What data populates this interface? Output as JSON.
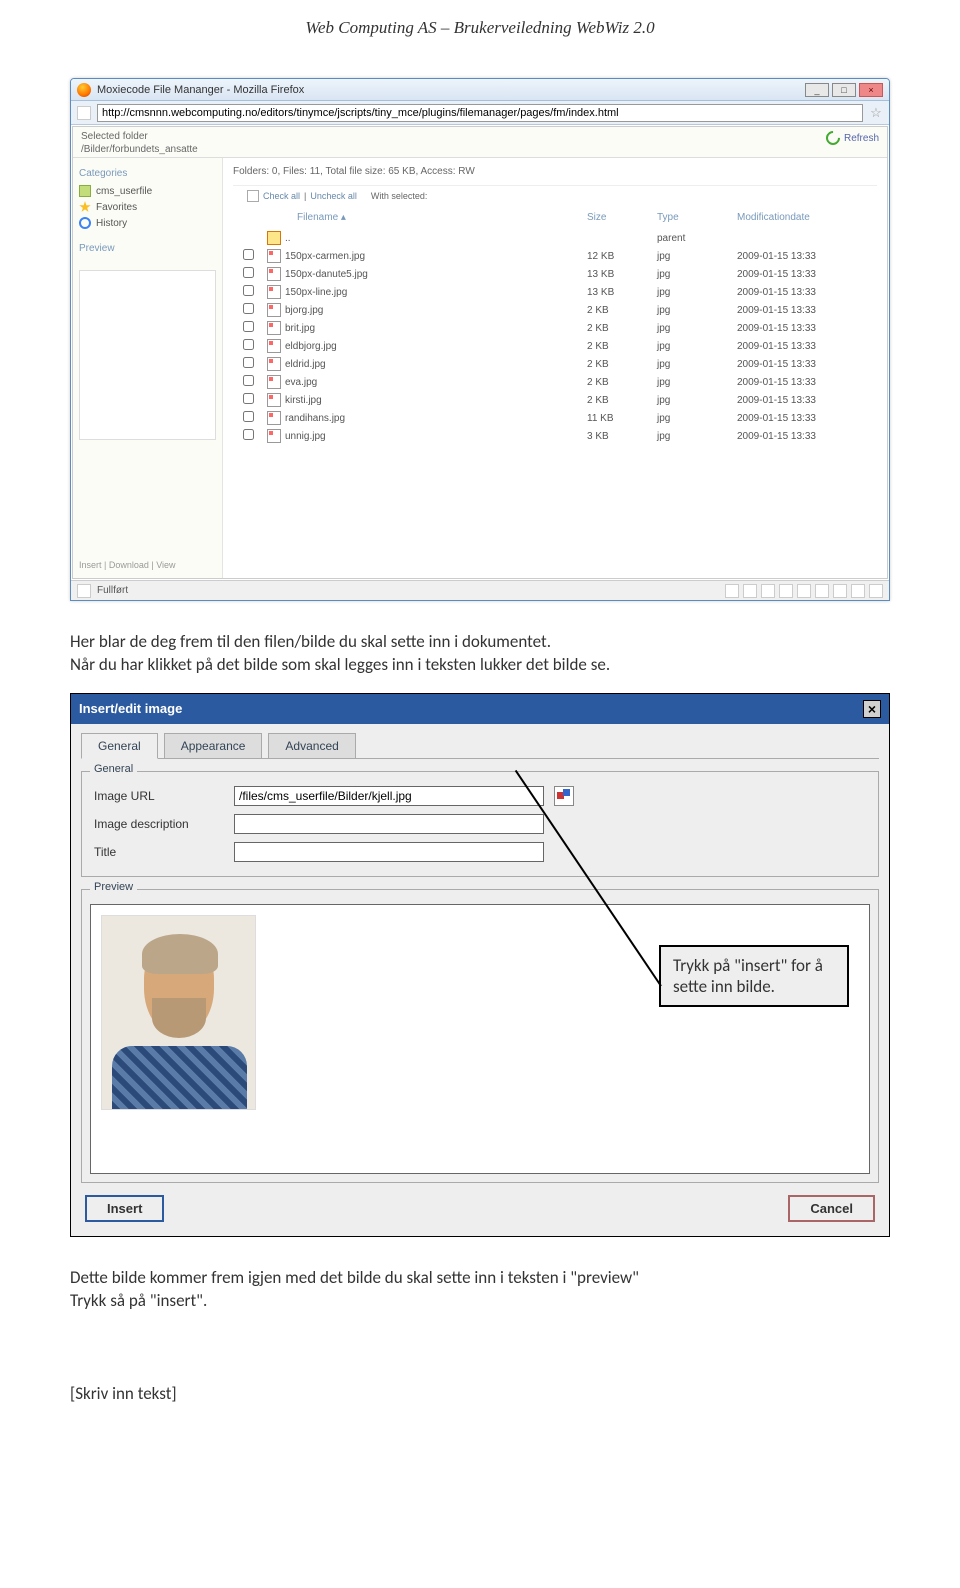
{
  "pageHeader": "Web Computing AS – Brukerveiledning WebWiz 2.0",
  "browser": {
    "title": "Moxiecode File Mananger - Mozilla Firefox",
    "url": "http://cmsnnn.webcomputing.no/editors/tinymce/jscripts/tiny_mce/plugins/filemanager/pages/fm/index.html"
  },
  "app": {
    "selectedFolderLabel": "Selected folder",
    "selectedFolderPath": "/Bilder/forbundets_ansatte",
    "refreshLabel": "Refresh",
    "sidebar": {
      "categories": "Categories",
      "items": [
        "cms_userfile",
        "Favorites",
        "History"
      ],
      "previewLabel": "Preview",
      "actions": "Insert | Download | View"
    },
    "main": {
      "infoLine": "Folders: 0, Files: 11, Total file size: 65 KB, Access: RW",
      "checkAll": "Check all",
      "uncheckAll": "Uncheck all",
      "withSelected": "With selected:",
      "headers": {
        "filename": "Filename",
        "size": "Size",
        "type": "Type",
        "date": "Modificationdate"
      },
      "parentRow": {
        "name": "..",
        "type": "parent"
      },
      "files": [
        {
          "name": "150px-carmen.jpg",
          "size": "12 KB",
          "type": "jpg",
          "date": "2009-01-15 13:33"
        },
        {
          "name": "150px-danute5.jpg",
          "size": "13 KB",
          "type": "jpg",
          "date": "2009-01-15 13:33"
        },
        {
          "name": "150px-line.jpg",
          "size": "13 KB",
          "type": "jpg",
          "date": "2009-01-15 13:33"
        },
        {
          "name": "bjorg.jpg",
          "size": "2 KB",
          "type": "jpg",
          "date": "2009-01-15 13:33"
        },
        {
          "name": "brit.jpg",
          "size": "2 KB",
          "type": "jpg",
          "date": "2009-01-15 13:33"
        },
        {
          "name": "eldbjorg.jpg",
          "size": "2 KB",
          "type": "jpg",
          "date": "2009-01-15 13:33"
        },
        {
          "name": "eldrid.jpg",
          "size": "2 KB",
          "type": "jpg",
          "date": "2009-01-15 13:33"
        },
        {
          "name": "eva.jpg",
          "size": "2 KB",
          "type": "jpg",
          "date": "2009-01-15 13:33"
        },
        {
          "name": "kirsti.jpg",
          "size": "2 KB",
          "type": "jpg",
          "date": "2009-01-15 13:33"
        },
        {
          "name": "randihans.jpg",
          "size": "11 KB",
          "type": "jpg",
          "date": "2009-01-15 13:33"
        },
        {
          "name": "unnig.jpg",
          "size": "3 KB",
          "type": "jpg",
          "date": "2009-01-15 13:33"
        }
      ]
    },
    "status": "Fullført"
  },
  "bodyText1": "Her blar de deg frem til den filen/bilde du skal sette inn i dokumentet.\nNår du har klikket på det bilde som skal legges inn i teksten lukker det bilde se.",
  "dialog": {
    "title": "Insert/edit image",
    "tabs": [
      "General",
      "Appearance",
      "Advanced"
    ],
    "legend": "General",
    "fields": {
      "imageUrlLabel": "Image URL",
      "imageUrlValue": "/files/cms_userfile/Bilder/kjell.jpg",
      "imageDescLabel": "Image description",
      "imageDescValue": "",
      "titleLabel": "Title",
      "titleValue": ""
    },
    "previewLegend": "Preview",
    "callout": "Trykk på \"insert\" for å sette inn bilde.",
    "insertBtn": "Insert",
    "cancelBtn": "Cancel"
  },
  "bodyText2": "Dette bilde kommer frem igjen med det bilde du skal sette inn i teksten i \"preview\"\nTrykk så på \"insert\".",
  "footer": "[Skriv inn tekst]"
}
